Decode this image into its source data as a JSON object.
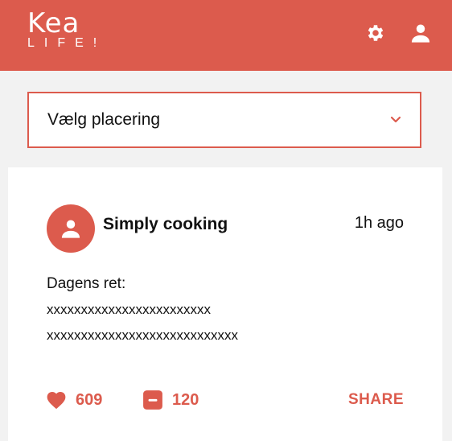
{
  "header": {
    "logo_main": "Kea",
    "logo_sub": "LIFE!",
    "settings_icon": "gear-icon",
    "profile_icon": "user-icon"
  },
  "location_select": {
    "value": "Vælg placering",
    "icon": "chevron-down-icon"
  },
  "post": {
    "author": "Simply cooking",
    "time": "1h ago",
    "title": "Dagens ret:",
    "lines": [
      "xxxxxxxxxxxxxxxxxxxxxxxx",
      "xxxxxxxxxxxxxxxxxxxxxxxxxxxx"
    ],
    "likes": "609",
    "comments": "120",
    "share_label": "SHARE"
  },
  "colors": {
    "accent": "#dc5b4d",
    "background": "#f2f2f2",
    "card": "#ffffff"
  }
}
